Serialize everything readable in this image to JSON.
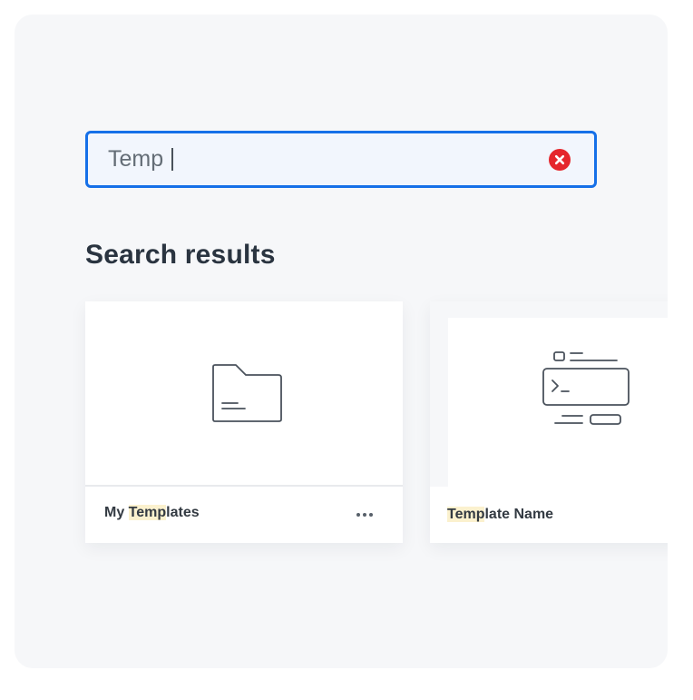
{
  "search": {
    "value": "Temp",
    "clear_icon": "clear-x-icon"
  },
  "results": {
    "heading": "Search results",
    "items": [
      {
        "title_highlight_before": "My ",
        "title_highlight": "Temp",
        "title_highlight_after": "lates",
        "icon": "folder-icon",
        "menu_icon": "more-horizontal-icon"
      },
      {
        "title_highlight_before": "",
        "title_highlight": "Temp",
        "title_highlight_after": "late Name",
        "icon": "terminal-template-icon"
      }
    ]
  },
  "colors": {
    "accent": "#1670e8",
    "clear": "#e5262c",
    "highlight": "#fbf1ce",
    "panel_bg": "#f6f7f9"
  }
}
